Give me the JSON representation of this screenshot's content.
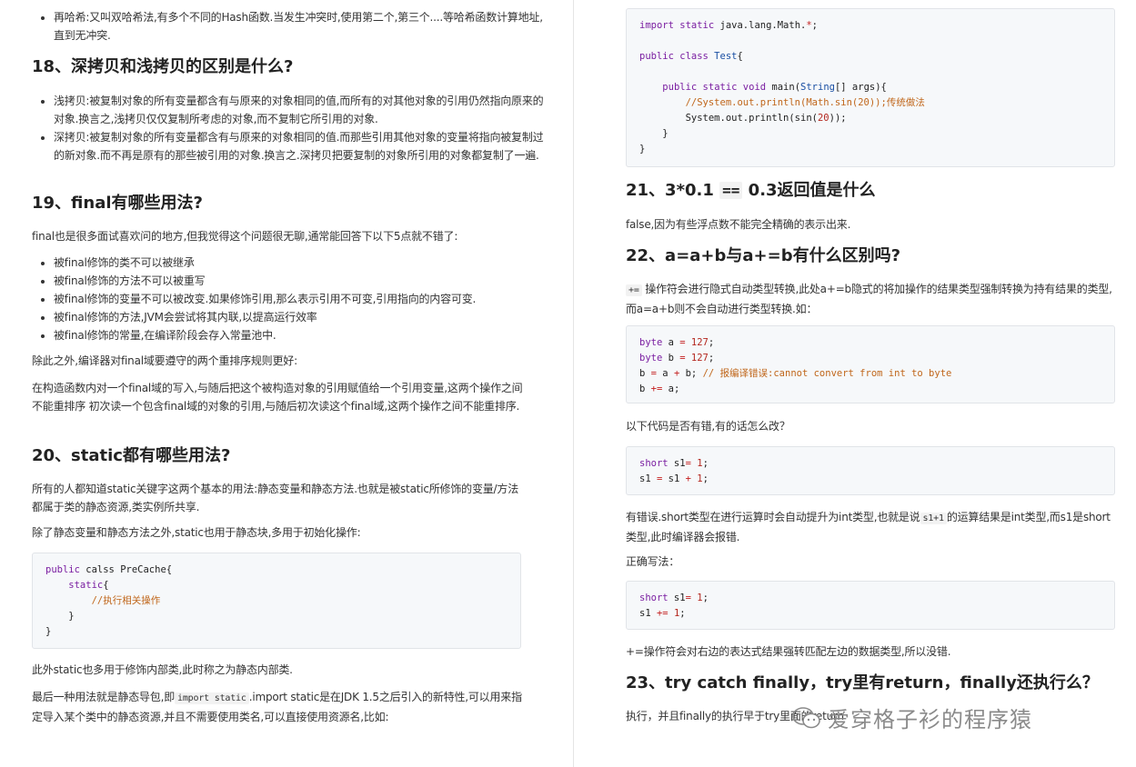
{
  "left": {
    "bullet_hash": "再哈希:又叫双哈希法,有多个不同的Hash函数.当发生冲突时,使用第二个,第三个....等哈希函数计算地址,直到无冲突.",
    "h18": "18、深拷贝和浅拷贝的区别是什么?",
    "shallow": "浅拷贝:被复制对象的所有变量都含有与原来的对象相同的值,而所有的对其他对象的引用仍然指向原来的对象.换言之,浅拷贝仅仅复制所考虑的对象,而不复制它所引用的对象.",
    "deep": "深拷贝:被复制对象的所有变量都含有与原来的对象相同的值.而那些引用其他对象的变量将指向被复制过的新对象.而不再是原有的那些被引用的对象.换言之.深拷贝把要复制的对象所引用的对象都复制了一遍.",
    "h19": "19、final有哪些用法?",
    "final_intro": "final也是很多面试喜欢问的地方,但我觉得这个问题很无聊,通常能回答下以下5点就不错了:",
    "final_items": [
      "被final修饰的类不可以被继承",
      "被final修饰的方法不可以被重写",
      "被final修饰的变量不可以被改变.如果修饰引用,那么表示引用不可变,引用指向的内容可变.",
      "被final修饰的方法,JVM会尝试将其内联,以提高运行效率",
      "被final修饰的常量,在编译阶段会存入常量池中."
    ],
    "final_reorder": "除此之外,编译器对final域要遵守的两个重排序规则更好:",
    "final_rule": "在构造函数内对一个final域的写入,与随后把这个被构造对象的引用赋值给一个引用变量,这两个操作之间不能重排序 初次读一个包含final域的对象的引用,与随后初次读这个final域,这两个操作之间不能重排序.",
    "h20": "20、static都有哪些用法?",
    "static_intro": "所有的人都知道static关键字这两个基本的用法:静态变量和静态方法.也就是被static所修饰的变量/方法都属于类的静态资源,类实例所共享.",
    "static_block": "除了静态变量和静态方法之外,static也用于静态块,多用于初始化操作:",
    "code_precache": {
      "l1_kw": "public",
      "l1_rest": " calss PreCache{",
      "l2_kw": "    static",
      "l2_rest": "{",
      "l3": "        //执行相关操作",
      "l4": "    }",
      "l5": "}"
    },
    "static_inner": "此外static也多用于修饰内部类,此时称之为静态内部类.",
    "static_import_a": "最后一种用法就是静态导包,即",
    "static_import_code": "import static",
    "static_import_b": ".import static是在JDK 1.5之后引入的新特性,可以用来指定导入某个类中的静态资源,并且不需要使用类名,可以直接使用资源名,比如:"
  },
  "right": {
    "code_test": {
      "l1_kw": "import static",
      "l1_rest": " java.lang.Math.",
      "l1_star": "*",
      "l1_end": ";",
      "l3_kw": "public class",
      "l3_cls": " Test",
      "l3_end": "{",
      "l5_ind": "    ",
      "l5_kw": "public static void",
      "l5_rest": " main(",
      "l5_cls": "String",
      "l5_end": "[] args){",
      "l6": "        //System.out.println(Math.sin(20));传统做法",
      "l7_a": "        System.out.println(sin(",
      "l7_num": "20",
      "l7_b": "));",
      "l8": "    }",
      "l9": "}"
    },
    "h21_a": "21、3*0.1 ",
    "h21_code": "==",
    "h21_b": " 0.3返回值是什么",
    "false_text": "false,因为有些浮点数不能完全精确的表示出来.",
    "h22": "22、a=a+b与a+=b有什么区别吗?",
    "pluseq_code": "+=",
    "pluseq_text": " 操作符会进行隐式自动类型转换,此处a+=b隐式的将加操作的结果类型强制转换为持有结果的类型,而a=a+b则不会自动进行类型转换.如：",
    "code_byte": {
      "l1_kw": "byte",
      "l1_rest": " a ",
      "l1_op": "=",
      "l1_num": " 127",
      "l1_end": ";",
      "l2_kw": "byte",
      "l2_rest": " b ",
      "l2_op": "=",
      "l2_num": " 127",
      "l2_end": ";",
      "l3_a": "b ",
      "l3_op1": "=",
      "l3_b": " a ",
      "l3_op2": "+",
      "l3_c": " b; ",
      "l3_cm": "// 报编译错误:cannot convert from int to byte",
      "l4_a": "b ",
      "l4_op": "+=",
      "l4_b": " a;"
    },
    "q_error": "以下代码是否有错,有的话怎么改？",
    "code_short1": {
      "l1_kw": "short",
      "l1_rest": " s1",
      "l1_op": "=",
      "l1_num": " 1",
      "l1_end": ";",
      "l2_a": "s1 ",
      "l2_op1": "=",
      "l2_b": " s1 ",
      "l2_op2": "+",
      "l2_num": " 1",
      "l2_end": ";"
    },
    "err_a": "有错误.short类型在进行运算时会自动提升为int类型,也就是说",
    "err_code": "s1+1",
    "err_b": "的运算结果是int类型,而s1是short类型,此时编译器会报错.",
    "correct": "正确写法：",
    "code_short2": {
      "l1_kw": "short",
      "l1_rest": " s1",
      "l1_op": "=",
      "l1_num": " 1",
      "l1_end": ";",
      "l2_a": "s1 ",
      "l2_op": "+=",
      "l2_num": " 1",
      "l2_end": ";"
    },
    "pluseq_expl": "+=操作符会对右边的表达式结果强转匹配左边的数据类型,所以没错.",
    "h23": "23、try catch finally，try里有return，finally还执行么？",
    "exec": "执行，并且finally的执行早于try里面的return"
  },
  "watermark": {
    "text": "爱穿格子衫的程序猿",
    "icon": "wechat-icon"
  }
}
